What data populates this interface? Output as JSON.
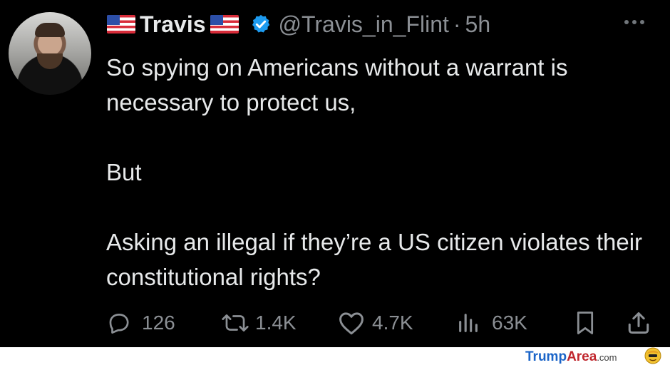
{
  "tweet": {
    "display_name": "Travis",
    "handle": "@Travis_in_Flint",
    "separator": "·",
    "time_ago": "5h",
    "paragraphs": [
      "So spying on Americans without a warrant is necessary to protect us,",
      "But",
      "Asking an illegal if they’re a US citizen violates their constitutional rights?"
    ],
    "stats": {
      "replies": "126",
      "reposts": "1.4K",
      "likes": "4.7K",
      "views": "63K"
    }
  },
  "footer": {
    "brand_primary": "Trump",
    "brand_secondary": "Area",
    "brand_suffix": ".com"
  },
  "colors": {
    "background": "#000000",
    "text": "#e7e9ea",
    "muted": "#8b8f94",
    "verified_blue": "#1d9bf0",
    "brand_blue": "#1a64c8",
    "brand_red": "#c0262d"
  }
}
